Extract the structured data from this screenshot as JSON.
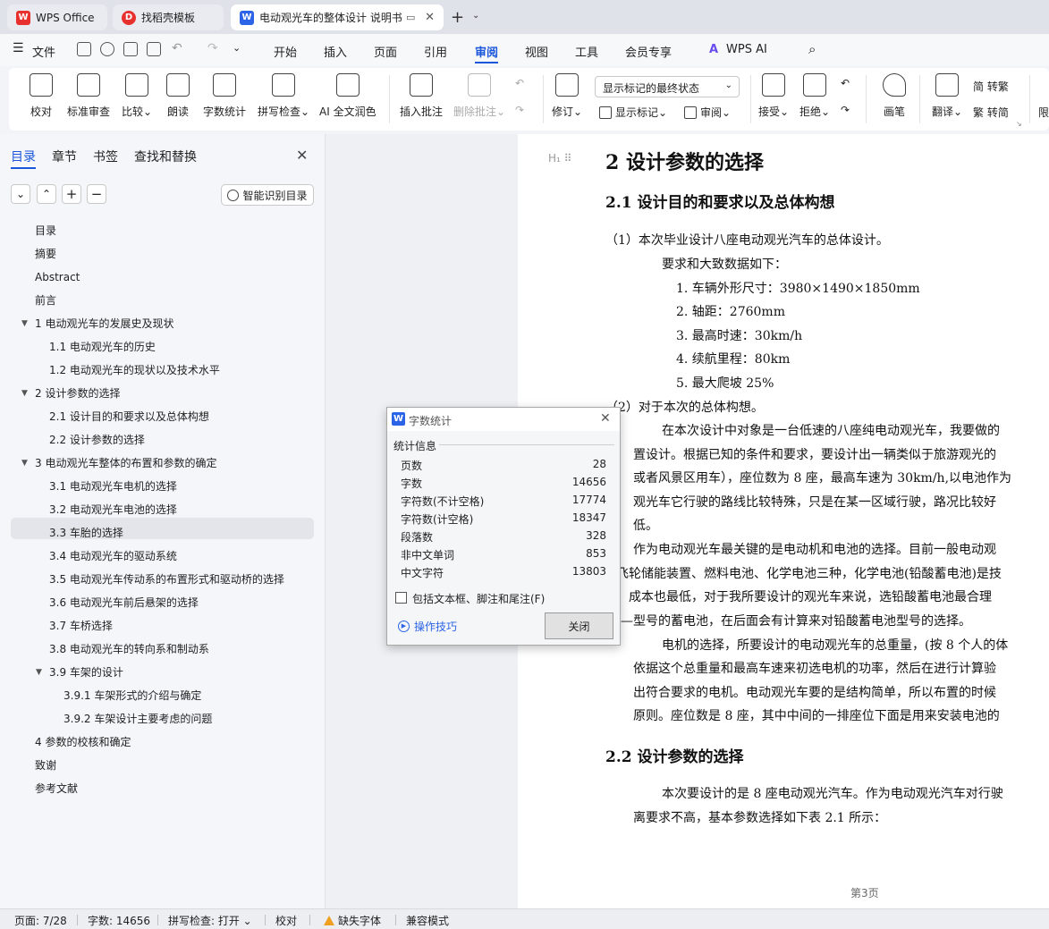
{
  "tabs": {
    "wps_office": "WPS Office",
    "template": "找稻壳模板",
    "document": "电动观光车的整体设计 说明书"
  },
  "menu": {
    "file": "文件",
    "items": [
      "开始",
      "插入",
      "页面",
      "引用",
      "审阅",
      "视图",
      "工具",
      "会员专享"
    ],
    "wps_ai": "WPS AI",
    "active": "审阅"
  },
  "ribbon": {
    "proofread": "校对",
    "standard_review": "标准审查",
    "compare": "比较",
    "read_aloud": "朗读",
    "word_count": "字数统计",
    "spell_check": "拼写检查",
    "ai_proofread": "AI 全文润色",
    "insert_comment": "插入批注",
    "delete_comment": "删除批注",
    "revise": "修订",
    "markup_select": "显示标记的最终状态",
    "show_markup": "显示标记",
    "review": "审阅",
    "accept": "接受",
    "reject": "拒绝",
    "pen": "画笔",
    "translate": "翻译",
    "to_traditional": "简 转繁",
    "to_simplified": "繁 转简",
    "limit": "限"
  },
  "nav": {
    "tabs": [
      "目录",
      "章节",
      "书签",
      "查找和替换"
    ],
    "smart_toc": "智能识别目录",
    "toc": [
      {
        "label": "目录",
        "level": 1
      },
      {
        "label": "摘要",
        "level": 1
      },
      {
        "label": "Abstract",
        "level": 1
      },
      {
        "label": "前言",
        "level": 1
      },
      {
        "label": "1 电动观光车的发展史及现状",
        "level": 1,
        "expanded": true
      },
      {
        "label": "1.1 电动观光车的历史",
        "level": 2
      },
      {
        "label": "1.2 电动观光车的现状以及技术水平",
        "level": 2
      },
      {
        "label": "2 设计参数的选择",
        "level": 1,
        "expanded": true,
        "selected": true
      },
      {
        "label": "2.1   设计目的和要求以及总体构想",
        "level": 2
      },
      {
        "label": "2.2 设计参数的选择",
        "level": 2
      },
      {
        "label": "3 电动观光车整体的布置和参数的确定",
        "level": 1,
        "expanded": true
      },
      {
        "label": "3.1 电动观光车电机的选择",
        "level": 2
      },
      {
        "label": "3.2 电动观光车电池的选择",
        "level": 2
      },
      {
        "label": "3.3 车胎的选择",
        "level": 2
      },
      {
        "label": "3.4 电动观光车的驱动系统",
        "level": 2
      },
      {
        "label": "3.5 电动观光车传动系的布置形式和驱动桥的选择",
        "level": 2
      },
      {
        "label": "3.6 电动观光车前后悬架的选择",
        "level": 2
      },
      {
        "label": "3.7 车桥选择",
        "level": 2
      },
      {
        "label": "3.8 电动观光车的转向系和制动系",
        "level": 2
      },
      {
        "label": "3.9 车架的设计",
        "level": 2,
        "expanded": true
      },
      {
        "label": "3.9.1 车架形式的介绍与确定",
        "level": 3
      },
      {
        "label": "3.9.2 车架设计主要考虑的问题",
        "level": 3
      },
      {
        "label": "4 参数的校核和确定",
        "level": 1
      },
      {
        "label": "致谢",
        "level": 1
      },
      {
        "label": "参考文献",
        "level": 1
      }
    ]
  },
  "doc": {
    "h1": "2 设计参数的选择",
    "h2_1": "2.1    设计目的和要求以及总体构想",
    "lines": [
      "（1）本次毕业设计八座电动观光汽车的总体设计。",
      "要求和大致数据如下：",
      "1. 车辆外形尺寸：3980×1490×1850mm",
      "2. 轴距：2760mm",
      "3. 最高时速：30km/h",
      "4. 续航里程：80km",
      "5. 最大爬坡 25%",
      "（2）对于本次的总体构想。",
      "在本次设计中对象是一台低速的八座纯电动观光车，我要做的",
      "置设计。根据已知的条件和要求，要设计出一辆类似于旅游观光的",
      "或者风景区用车），座位数为 8 座，最高车速为 30km/h,以电池作为",
      "观光车它行驶的路线比较特殊，只是在某一区域行驶，路况比较好",
      "低。",
      "作为电动观光车最关键的是电动机和电池的选择。目前一般电动观",
      "飞轮储能装置、燃料电池、化学电池三种，化学电池(铅酸蓄电池)是技",
      "，成本也最低，对于我所要设计的观光车来说，选铅酸蓄电池最合理",
      "—型号的蓄电池，在后面会有计算来对铅酸蓄电池型号的选择。",
      "电机的选择，所要设计的电动观光车的总重量，(按 8 个人的体",
      "依据这个总重量和最高车速来初选电机的功率，然后在进行计算验",
      "出符合要求的电机。电动观光车要的是结构简单，所以布置的时候",
      "原则。座位数是 8 座，其中中间的一排座位下面是用来安装电池的"
    ],
    "h2_2": "2.2 设计参数的选择",
    "lines2": [
      "本次要设计的是 8 座电动观光汽车。作为电动观光汽车对行驶",
      "离要求不高，基本参数选择如下表 2.1 所示："
    ],
    "page_number": "第3页"
  },
  "dialog": {
    "title": "字数统计",
    "group": "统计信息",
    "rows": [
      {
        "k": "页数",
        "v": "28"
      },
      {
        "k": "字数",
        "v": "14656"
      },
      {
        "k": "字符数(不计空格)",
        "v": "17774"
      },
      {
        "k": "字符数(计空格)",
        "v": "18347"
      },
      {
        "k": "段落数",
        "v": "328"
      },
      {
        "k": "非中文单词",
        "v": "853"
      },
      {
        "k": "中文字符",
        "v": "13803"
      }
    ],
    "include_label": "包括文本框、脚注和尾注(F)",
    "tips": "操作技巧",
    "close": "关闭"
  },
  "status": {
    "page": "页面: 7/28",
    "words": "字数: 14656",
    "spell": "拼写检查: 打开",
    "proofread": "校对",
    "missing_font": "缺失字体",
    "compat": "兼容模式"
  }
}
